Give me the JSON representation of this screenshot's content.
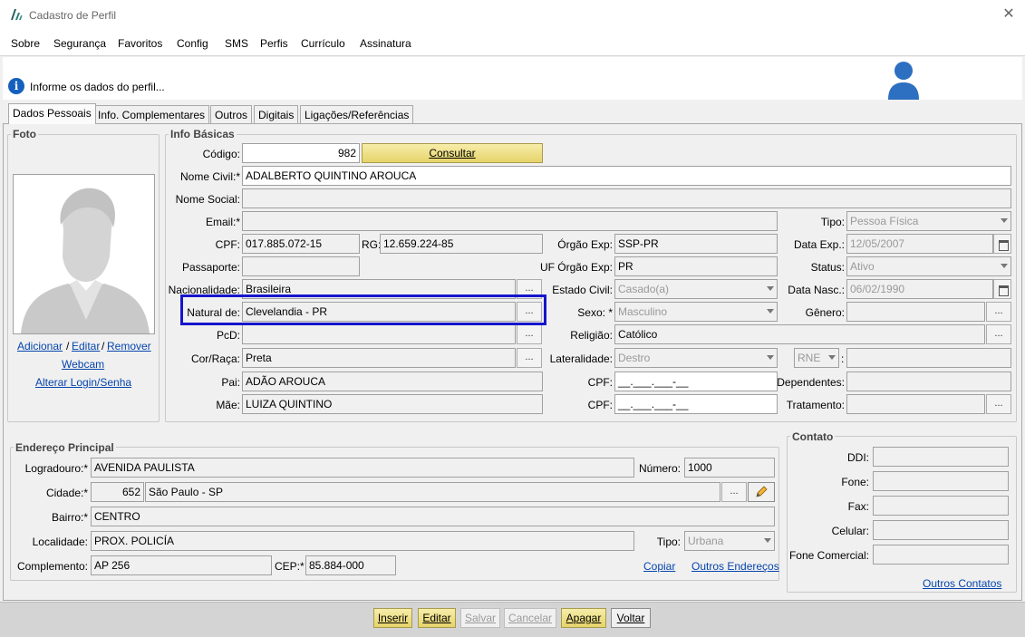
{
  "window": {
    "title": "Cadastro de Perfil",
    "close_glyph": "✕"
  },
  "menu": [
    "Sobre",
    "Segurança",
    "Favoritos",
    "Config",
    "SMS",
    "Perfis",
    "Currículo",
    "Assinatura"
  ],
  "info": {
    "icon_glyph": "i",
    "text": "Informe os dados do perfil..."
  },
  "tabs": [
    "Dados Pessoais",
    "Info. Complementares",
    "Outros",
    "Digitais",
    "Ligações/Referências"
  ],
  "foto": {
    "legend": "Foto",
    "links": {
      "adicionar": "Adicionar",
      "sep1": "/",
      "editar": "Editar",
      "sep2": "/",
      "remover": "Remover",
      "webcam": "Webcam",
      "alterar_login": "Alterar Login/Senha"
    }
  },
  "info_basicas": {
    "legend": "Info Básicas",
    "codigo": {
      "label": "Código:",
      "value": "982"
    },
    "consultar_label": "Consultar",
    "nome_civil": {
      "label": "Nome Civil:*",
      "value": "ADALBERTO QUINTINO AROUCA"
    },
    "nome_social": {
      "label": "Nome Social:",
      "value": ""
    },
    "email": {
      "label": "Email:*",
      "value": ""
    },
    "tipo": {
      "label": "Tipo:",
      "value": "Pessoa Física"
    },
    "cpf": {
      "label": "CPF:",
      "value": "017.885.072-15"
    },
    "rg": {
      "label": "RG:",
      "value": "12.659.224-85"
    },
    "orgao_exp": {
      "label": "Órgão Exp:",
      "value": "SSP-PR"
    },
    "data_exp": {
      "label": "Data Exp.:",
      "value": "12/05/2007"
    },
    "passaporte": {
      "label": "Passaporte:",
      "value": ""
    },
    "uf_orgao_exp": {
      "label": "UF Órgão Exp:",
      "value": "PR"
    },
    "status": {
      "label": "Status:",
      "value": "Ativo"
    },
    "nacionalidade": {
      "label": "Nacionalidade:",
      "value": "Brasileira"
    },
    "estado_civil": {
      "label": "Estado Civil:",
      "value": "Casado(a)"
    },
    "data_nasc": {
      "label": "Data Nasc.:",
      "value": "06/02/1990"
    },
    "natural_de": {
      "label": "Natural de:",
      "value": "Clevelandia - PR"
    },
    "sexo": {
      "label": "Sexo: *",
      "value": "Masculino"
    },
    "genero": {
      "label": "Gênero:",
      "value": ""
    },
    "pcd": {
      "label": "PcD:",
      "value": ""
    },
    "religiao": {
      "label": "Religião:",
      "value": "Católico"
    },
    "cor_raca": {
      "label": "Cor/Raça:",
      "value": "Preta"
    },
    "lateralidade": {
      "label": "Lateralidade:",
      "value": "Destro"
    },
    "rne": {
      "value": "RNE",
      "colon": ":",
      "field": ""
    },
    "pai": {
      "label": "Pai:",
      "value": "ADÃO AROUCA"
    },
    "cpf_pai": {
      "label": "CPF:",
      "value": "__.___.___-__"
    },
    "dependentes": {
      "label": "Dependentes:",
      "value": ""
    },
    "mae": {
      "label": "Mãe:",
      "value": "LUIZA QUINTINO"
    },
    "cpf_mae": {
      "label": "CPF:",
      "value": "__.___.___-__"
    },
    "tratamento": {
      "label": "Tratamento:",
      "value": ""
    },
    "dots_label": "..."
  },
  "endereco": {
    "legend": "Endereço Principal",
    "logradouro": {
      "label": "Logradouro:*",
      "value": "AVENIDA PAULISTA"
    },
    "numero": {
      "label": "Número:",
      "value": "1000"
    },
    "cidade": {
      "label": "Cidade:*",
      "code": "652",
      "value": "São Paulo - SP"
    },
    "bairro": {
      "label": "Bairro:*",
      "value": "CENTRO"
    },
    "localidade": {
      "label": "Localidade:",
      "value": "PROX. POLICÍA"
    },
    "tipo": {
      "label": "Tipo:",
      "value": "Urbana"
    },
    "complemento": {
      "label": "Complemento:",
      "value": "AP 256"
    },
    "cep": {
      "label": "CEP:*",
      "value": "85.884-000"
    },
    "copiar": "Copiar",
    "outros_enderecos": "Outros Endereços"
  },
  "contato": {
    "legend": "Contato",
    "ddi": {
      "label": "DDI:",
      "value": ""
    },
    "fone": {
      "label": "Fone:",
      "value": ""
    },
    "fax": {
      "label": "Fax:",
      "value": ""
    },
    "celular": {
      "label": "Celular:",
      "value": ""
    },
    "fone_comercial": {
      "label": "Fone Comercial:",
      "value": ""
    },
    "outros_contatos": "Outros Contatos"
  },
  "actions": [
    "Inserir",
    "Editar",
    "Salvar",
    "Cancelar",
    "Apagar",
    "Voltar"
  ]
}
